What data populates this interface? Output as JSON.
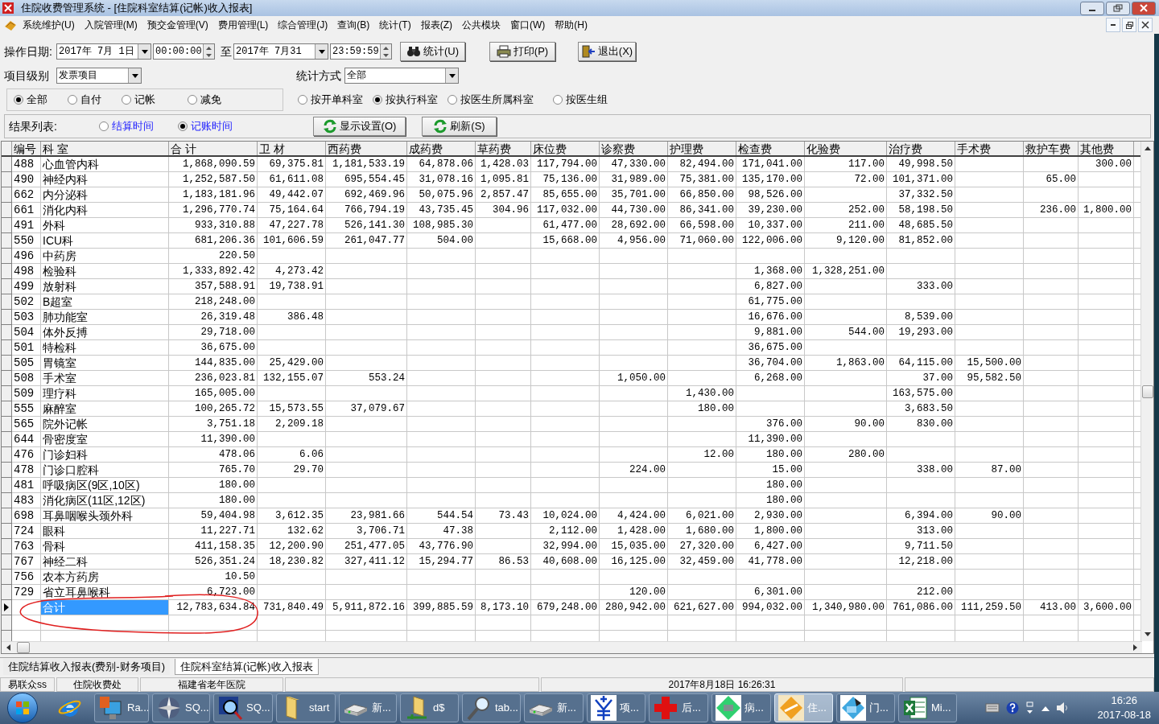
{
  "window": {
    "title": "住院收费管理系统 - [住院科室结算(记帐)收入报表]"
  },
  "menu": [
    "系统维护(U)",
    "入院管理(M)",
    "预交金管理(V)",
    "费用管理(L)",
    "综合管理(J)",
    "查询(B)",
    "统计(T)",
    "报表(Z)",
    "公共模块",
    "窗口(W)",
    "帮助(H)"
  ],
  "filters": {
    "date_label": "操作日期:",
    "start_date": "2017年 7月 1日",
    "start_time": "00:00:00",
    "to_label": "至",
    "end_date": "2017年 7月31",
    "end_time": "23:59:59",
    "level_label": "项目级别",
    "level_value": "发票项目",
    "method_label": "统计方式",
    "method_value": "全部"
  },
  "toolbar_buttons": [
    "统计(U)",
    "打印(P)",
    "退出(X)"
  ],
  "payment_radios": [
    {
      "label": "全部",
      "selected": true
    },
    {
      "label": "自付",
      "selected": false
    },
    {
      "label": "记帐",
      "selected": false
    },
    {
      "label": "减免",
      "selected": false
    }
  ],
  "grouping_radios": [
    {
      "label": "按开单科室",
      "selected": false
    },
    {
      "label": "按执行科室",
      "selected": true
    },
    {
      "label": "按医生所属科室",
      "selected": false
    },
    {
      "label": "按医生组",
      "selected": false
    }
  ],
  "result_list": {
    "label": "结果列表:",
    "radios": [
      {
        "label": "结算时间",
        "selected": false
      },
      {
        "label": "记账时间",
        "selected": true
      }
    ],
    "buttons": [
      "显示设置(O)",
      "刷新(S)"
    ]
  },
  "table": {
    "columns": [
      "编号",
      "科 室",
      "合 计",
      "卫 材",
      "西药费",
      "成药费",
      "草药费",
      "床位费",
      "诊察费",
      "护理费",
      "检查费",
      "化验费",
      "治疗费",
      "手术费",
      "救护车费",
      "其他费"
    ],
    "rows": [
      {
        "selected": false,
        "cells": [
          "488",
          "心血管内科",
          "1,868,090.59",
          "69,375.81",
          "1,181,533.19",
          "64,878.06",
          "1,428.03",
          "117,794.00",
          "47,330.00",
          "82,494.00",
          "171,041.00",
          "117.00",
          "49,998.50",
          null,
          null,
          "300.00"
        ]
      },
      {
        "selected": false,
        "cells": [
          "490",
          "神经内科",
          "1,252,587.50",
          "61,611.08",
          "695,554.45",
          "31,078.16",
          "1,095.81",
          "75,136.00",
          "31,989.00",
          "75,381.00",
          "135,170.00",
          "72.00",
          "101,371.00",
          null,
          "65.00",
          null
        ]
      },
      {
        "selected": false,
        "cells": [
          "662",
          "内分泌科",
          "1,183,181.96",
          "49,442.07",
          "692,469.96",
          "50,075.96",
          "2,857.47",
          "85,655.00",
          "35,701.00",
          "66,850.00",
          "98,526.00",
          null,
          "37,332.50",
          null,
          null,
          null
        ]
      },
      {
        "selected": false,
        "cells": [
          "661",
          "消化内科",
          "1,296,770.74",
          "75,164.64",
          "766,794.19",
          "43,735.45",
          "304.96",
          "117,032.00",
          "44,730.00",
          "86,341.00",
          "39,230.00",
          "252.00",
          "58,198.50",
          null,
          "236.00",
          "1,800.00"
        ]
      },
      {
        "selected": false,
        "cells": [
          "491",
          "外科",
          "933,310.88",
          "47,227.78",
          "526,141.30",
          "108,985.30",
          null,
          "61,477.00",
          "28,692.00",
          "66,598.00",
          "10,337.00",
          "211.00",
          "48,685.50",
          null,
          null,
          null
        ]
      },
      {
        "selected": false,
        "cells": [
          "550",
          "ICU科",
          "681,206.36",
          "101,606.59",
          "261,047.77",
          "504.00",
          null,
          "15,668.00",
          "4,956.00",
          "71,060.00",
          "122,006.00",
          "9,120.00",
          "81,852.00",
          null,
          null,
          null
        ]
      },
      {
        "selected": false,
        "cells": [
          "496",
          "中药房",
          "220.50",
          null,
          null,
          null,
          null,
          null,
          null,
          null,
          null,
          null,
          null,
          null,
          null,
          null
        ]
      },
      {
        "selected": false,
        "cells": [
          "498",
          "检验科",
          "1,333,892.42",
          "4,273.42",
          null,
          null,
          null,
          null,
          null,
          null,
          "1,368.00",
          "1,328,251.00",
          null,
          null,
          null,
          null
        ]
      },
      {
        "selected": false,
        "cells": [
          "499",
          "放射科",
          "357,588.91",
          "19,738.91",
          null,
          null,
          null,
          null,
          null,
          null,
          "6,827.00",
          null,
          "333.00",
          null,
          null,
          null
        ]
      },
      {
        "selected": false,
        "cells": [
          "502",
          "B超室",
          "218,248.00",
          null,
          null,
          null,
          null,
          null,
          null,
          null,
          "61,775.00",
          null,
          null,
          null,
          null,
          null
        ]
      },
      {
        "selected": false,
        "cells": [
          "503",
          "肺功能室",
          "26,319.48",
          "386.48",
          null,
          null,
          null,
          null,
          null,
          null,
          "16,676.00",
          null,
          "8,539.00",
          null,
          null,
          null
        ]
      },
      {
        "selected": false,
        "cells": [
          "504",
          "体外反搏",
          "29,718.00",
          null,
          null,
          null,
          null,
          null,
          null,
          null,
          "9,881.00",
          "544.00",
          "19,293.00",
          null,
          null,
          null
        ]
      },
      {
        "selected": false,
        "cells": [
          "501",
          "特检科",
          "36,675.00",
          null,
          null,
          null,
          null,
          null,
          null,
          null,
          "36,675.00",
          null,
          null,
          null,
          null,
          null
        ]
      },
      {
        "selected": false,
        "cells": [
          "505",
          "胃镜室",
          "144,835.00",
          "25,429.00",
          null,
          null,
          null,
          null,
          null,
          null,
          "36,704.00",
          "1,863.00",
          "64,115.00",
          "15,500.00",
          null,
          null
        ]
      },
      {
        "selected": false,
        "cells": [
          "508",
          "手术室",
          "236,023.81",
          "132,155.07",
          "553.24",
          null,
          null,
          null,
          "1,050.00",
          null,
          "6,268.00",
          null,
          "37.00",
          "95,582.50",
          null,
          null
        ]
      },
      {
        "selected": false,
        "cells": [
          "509",
          "理疗科",
          "165,005.00",
          null,
          null,
          null,
          null,
          null,
          null,
          "1,430.00",
          null,
          null,
          "163,575.00",
          null,
          null,
          null
        ]
      },
      {
        "selected": false,
        "cells": [
          "555",
          "麻醉室",
          "100,265.72",
          "15,573.55",
          "37,079.67",
          null,
          null,
          null,
          null,
          "180.00",
          null,
          null,
          "3,683.50",
          null,
          null,
          null
        ]
      },
      {
        "selected": false,
        "cells": [
          "565",
          "院外记帐",
          "3,751.18",
          "2,209.18",
          null,
          null,
          null,
          null,
          null,
          null,
          "376.00",
          "90.00",
          "830.00",
          null,
          null,
          null
        ]
      },
      {
        "selected": false,
        "cells": [
          "644",
          "骨密度室",
          "11,390.00",
          null,
          null,
          null,
          null,
          null,
          null,
          null,
          "11,390.00",
          null,
          null,
          null,
          null,
          null
        ]
      },
      {
        "selected": false,
        "cells": [
          "476",
          "门诊妇科",
          "478.06",
          "6.06",
          null,
          null,
          null,
          null,
          null,
          "12.00",
          "180.00",
          "280.00",
          null,
          null,
          null,
          null
        ]
      },
      {
        "selected": false,
        "cells": [
          "478",
          "门诊口腔科",
          "765.70",
          "29.70",
          null,
          null,
          null,
          null,
          "224.00",
          null,
          "15.00",
          null,
          "338.00",
          "87.00",
          null,
          null
        ]
      },
      {
        "selected": false,
        "cells": [
          "481",
          "呼吸病区(9区,10区)",
          "180.00",
          null,
          null,
          null,
          null,
          null,
          null,
          null,
          "180.00",
          null,
          null,
          null,
          null,
          null
        ]
      },
      {
        "selected": false,
        "cells": [
          "483",
          "消化病区(11区,12区)",
          "180.00",
          null,
          null,
          null,
          null,
          null,
          null,
          null,
          "180.00",
          null,
          null,
          null,
          null,
          null
        ]
      },
      {
        "selected": false,
        "cells": [
          "698",
          "耳鼻咽喉头颈外科",
          "59,404.98",
          "3,612.35",
          "23,981.66",
          "544.54",
          "73.43",
          "10,024.00",
          "4,424.00",
          "6,021.00",
          "2,930.00",
          null,
          "6,394.00",
          "90.00",
          null,
          null
        ]
      },
      {
        "selected": false,
        "cells": [
          "724",
          "眼科",
          "11,227.71",
          "132.62",
          "3,706.71",
          "47.38",
          null,
          "2,112.00",
          "1,428.00",
          "1,680.00",
          "1,800.00",
          null,
          "313.00",
          null,
          null,
          null
        ]
      },
      {
        "selected": false,
        "cells": [
          "763",
          "骨科",
          "411,158.35",
          "12,200.90",
          "251,477.05",
          "43,776.90",
          null,
          "32,994.00",
          "15,035.00",
          "27,320.00",
          "6,427.00",
          null,
          "9,711.50",
          null,
          null,
          null
        ]
      },
      {
        "selected": false,
        "cells": [
          "767",
          "神经二科",
          "526,351.24",
          "18,230.82",
          "327,411.12",
          "15,294.77",
          "86.53",
          "40,608.00",
          "16,125.00",
          "32,459.00",
          "41,778.00",
          null,
          "12,218.00",
          null,
          null,
          null
        ]
      },
      {
        "selected": false,
        "cells": [
          "756",
          "农本方药房",
          "10.50",
          null,
          null,
          null,
          null,
          null,
          null,
          null,
          null,
          null,
          null,
          null,
          null,
          null
        ]
      },
      {
        "selected": false,
        "cells": [
          "729",
          "省立耳鼻喉科",
          "6,723.00",
          null,
          null,
          null,
          null,
          null,
          "120.00",
          null,
          "6,301.00",
          null,
          "212.00",
          null,
          null,
          null
        ]
      },
      {
        "selected": true,
        "cells": [
          null,
          "合计",
          "12,783,634.84",
          "731,840.49",
          "5,911,872.16",
          "399,885.59",
          "8,173.10",
          "679,248.00",
          "280,942.00",
          "621,627.00",
          "994,032.00",
          "1,340,980.00",
          "761,086.00",
          "111,259.50",
          "413.00",
          "3,600.00"
        ]
      }
    ]
  },
  "report_tabs": [
    {
      "label": "住院结算收入报表(费别-财务项目)",
      "selected": false
    },
    {
      "label": "住院科室结算(记帐)收入报表",
      "selected": true
    }
  ],
  "status_bar": {
    "panels": [
      "易联众ss",
      "住院收费处",
      "福建省老年医院"
    ],
    "datetime": "2017年8月18日 16:26:31"
  },
  "taskbar": {
    "items": [
      {
        "label": "Ra...",
        "selected": false
      },
      {
        "label": "SQ...",
        "selected": false
      },
      {
        "label": "SQ...",
        "selected": false
      },
      {
        "label": "start",
        "selected": false
      },
      {
        "label": "新...",
        "selected": false
      },
      {
        "label": "d$",
        "selected": false
      },
      {
        "label": "tab...",
        "selected": false
      },
      {
        "label": "新...",
        "selected": false
      },
      {
        "label": "项...",
        "selected": false
      },
      {
        "label": "后...",
        "selected": false
      },
      {
        "label": "病...",
        "selected": false
      },
      {
        "label": "住...",
        "selected": true
      },
      {
        "label": "门...",
        "selected": false
      },
      {
        "label": "Mi...",
        "selected": false
      }
    ],
    "clock": {
      "time": "16:26",
      "date": "2017-08-18"
    }
  }
}
